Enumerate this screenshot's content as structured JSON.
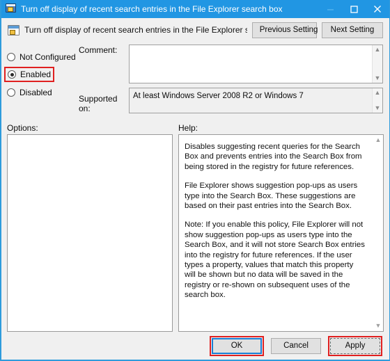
{
  "window": {
    "title": "Turn off display of recent search entries in the File Explorer search box",
    "icon": "policy-setting-icon",
    "controls": {
      "minimize": "minimize-icon",
      "maximize": "maximize-icon",
      "close": "close-icon"
    }
  },
  "header": {
    "setting_name": "Turn off display of recent search entries in the File Explorer search box",
    "previous_setting": "Previous Setting",
    "next_setting": "Next Setting"
  },
  "state_options": [
    {
      "label": "Not Configured",
      "selected": false,
      "highlighted": false
    },
    {
      "label": "Enabled",
      "selected": true,
      "highlighted": true
    },
    {
      "label": "Disabled",
      "selected": false,
      "highlighted": false
    }
  ],
  "comment": {
    "label": "Comment:",
    "value": "",
    "placeholder": ""
  },
  "supported_on": {
    "label": "Supported on:",
    "value": "At least Windows Server 2008 R2 or Windows 7"
  },
  "options": {
    "label": "Options:",
    "content": ""
  },
  "help": {
    "label": "Help:",
    "paragraphs": [
      "Disables suggesting recent queries for the Search Box and prevents entries into the Search Box from being stored in the registry for future references.",
      "File Explorer shows suggestion pop-ups as users type into the Search Box.  These suggestions are based on their past entries into the Search Box.",
      "Note: If you enable this policy, File Explorer will not show suggestion pop-ups as users type into the Search Box, and it will not store Search Box entries into the registry for future references.  If the user types a property, values that match this property will be shown but no data will be saved in the registry or re-shown on subsequent uses of the search box."
    ]
  },
  "footer": {
    "ok": "OK",
    "cancel": "Cancel",
    "apply": "Apply"
  },
  "colors": {
    "titlebar": "#2196e3",
    "highlight_red": "#e02020",
    "focus_blue": "#1a7fd4",
    "dialog_bg": "#f0f0f0"
  }
}
